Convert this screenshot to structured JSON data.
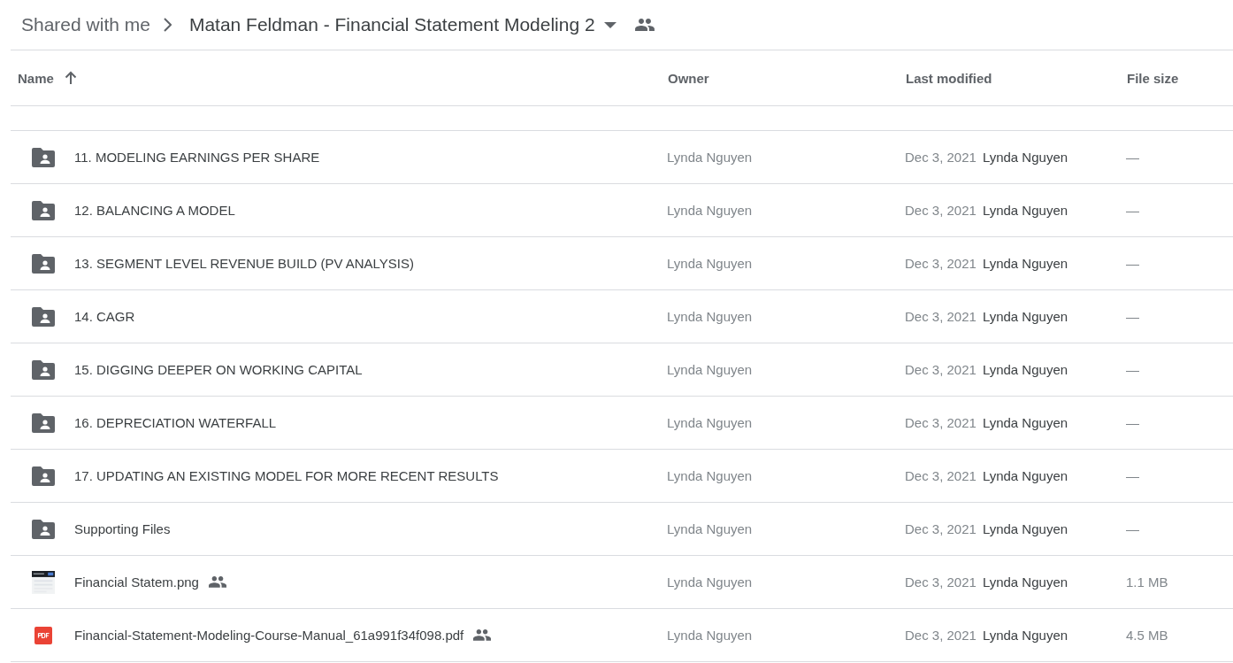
{
  "breadcrumb": {
    "parent": "Shared with me",
    "current": "Matan Feldman - Financial Statement Modeling 2",
    "shared": true
  },
  "table": {
    "columns": [
      {
        "label": "Name",
        "sorted": true
      },
      {
        "label": "Owner",
        "sorted": false
      },
      {
        "label": "Last modified",
        "sorted": false
      },
      {
        "label": "File size",
        "sorted": false
      }
    ],
    "rows": [
      {
        "kind": "folder",
        "name": "11. MODELING EARNINGS PER SHARE",
        "shared": false,
        "owner": "Lynda Nguyen",
        "modified_date": "Dec 3, 2021",
        "modified_by": "Lynda Nguyen",
        "size": "—"
      },
      {
        "kind": "folder",
        "name": "12. BALANCING A MODEL",
        "shared": false,
        "owner": "Lynda Nguyen",
        "modified_date": "Dec 3, 2021",
        "modified_by": "Lynda Nguyen",
        "size": "—"
      },
      {
        "kind": "folder",
        "name": "13. SEGMENT LEVEL REVENUE BUILD (PV ANALYSIS)",
        "shared": false,
        "owner": "Lynda Nguyen",
        "modified_date": "Dec 3, 2021",
        "modified_by": "Lynda Nguyen",
        "size": "—"
      },
      {
        "kind": "folder",
        "name": "14. CAGR",
        "shared": false,
        "owner": "Lynda Nguyen",
        "modified_date": "Dec 3, 2021",
        "modified_by": "Lynda Nguyen",
        "size": "—"
      },
      {
        "kind": "folder",
        "name": "15. DIGGING DEEPER ON WORKING CAPITAL",
        "shared": false,
        "owner": "Lynda Nguyen",
        "modified_date": "Dec 3, 2021",
        "modified_by": "Lynda Nguyen",
        "size": "—"
      },
      {
        "kind": "folder",
        "name": "16. DEPRECIATION WATERFALL",
        "shared": false,
        "owner": "Lynda Nguyen",
        "modified_date": "Dec 3, 2021",
        "modified_by": "Lynda Nguyen",
        "size": "—"
      },
      {
        "kind": "folder",
        "name": "17. UPDATING AN EXISTING MODEL FOR MORE RECENT RESULTS",
        "shared": false,
        "owner": "Lynda Nguyen",
        "modified_date": "Dec 3, 2021",
        "modified_by": "Lynda Nguyen",
        "size": "—"
      },
      {
        "kind": "folder",
        "name": "Supporting Files",
        "shared": false,
        "owner": "Lynda Nguyen",
        "modified_date": "Dec 3, 2021",
        "modified_by": "Lynda Nguyen",
        "size": "—"
      },
      {
        "name": "Financial Statem.png",
        "shared": true,
        "owner": "Lynda Nguyen",
        "modified_date": "Dec 3, 2021",
        "modified_by": "Lynda Nguyen",
        "size": "1.1 MB"
      },
      {
        "kind": "pdf",
        "name": "Financial-Statement-Modeling-Course-Manual_61a991f34f098.pdf",
        "shared": true,
        "owner": "Lynda Nguyen",
        "modified_date": "Dec 3, 2021",
        "modified_by": "Lynda Nguyen",
        "size": "4.5 MB"
      }
    ]
  }
}
